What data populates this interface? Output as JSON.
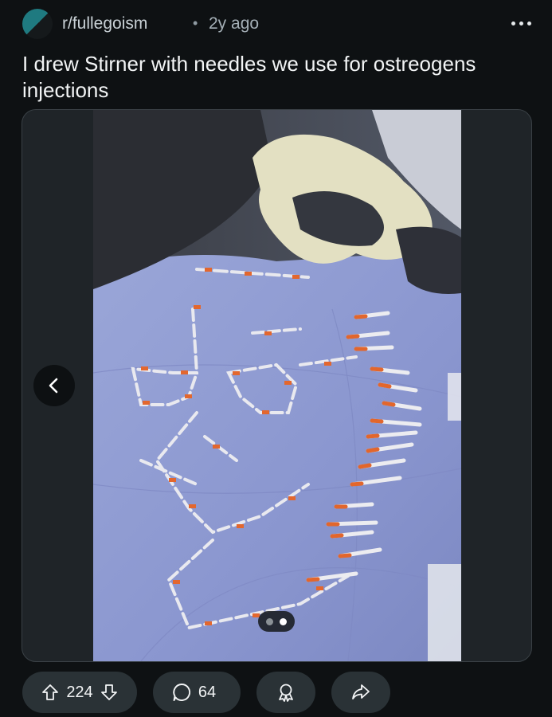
{
  "post": {
    "subreddit": "r/fullegoism",
    "separator": "•",
    "age": "2y ago",
    "title": "I drew Stirner with needles we use for ostreogens injections"
  },
  "media": {
    "gallery_index": 2,
    "gallery_total": 2
  },
  "actions": {
    "upvotes": "224",
    "comments": "64"
  },
  "icons": [
    "more-icon",
    "chevron-left-icon",
    "upvote-icon",
    "downvote-icon",
    "comment-icon",
    "award-icon",
    "share-icon"
  ],
  "colors": {
    "background": "#0e1113",
    "pill": "#2a3236",
    "subreddit_icon": "#1f7a80"
  }
}
